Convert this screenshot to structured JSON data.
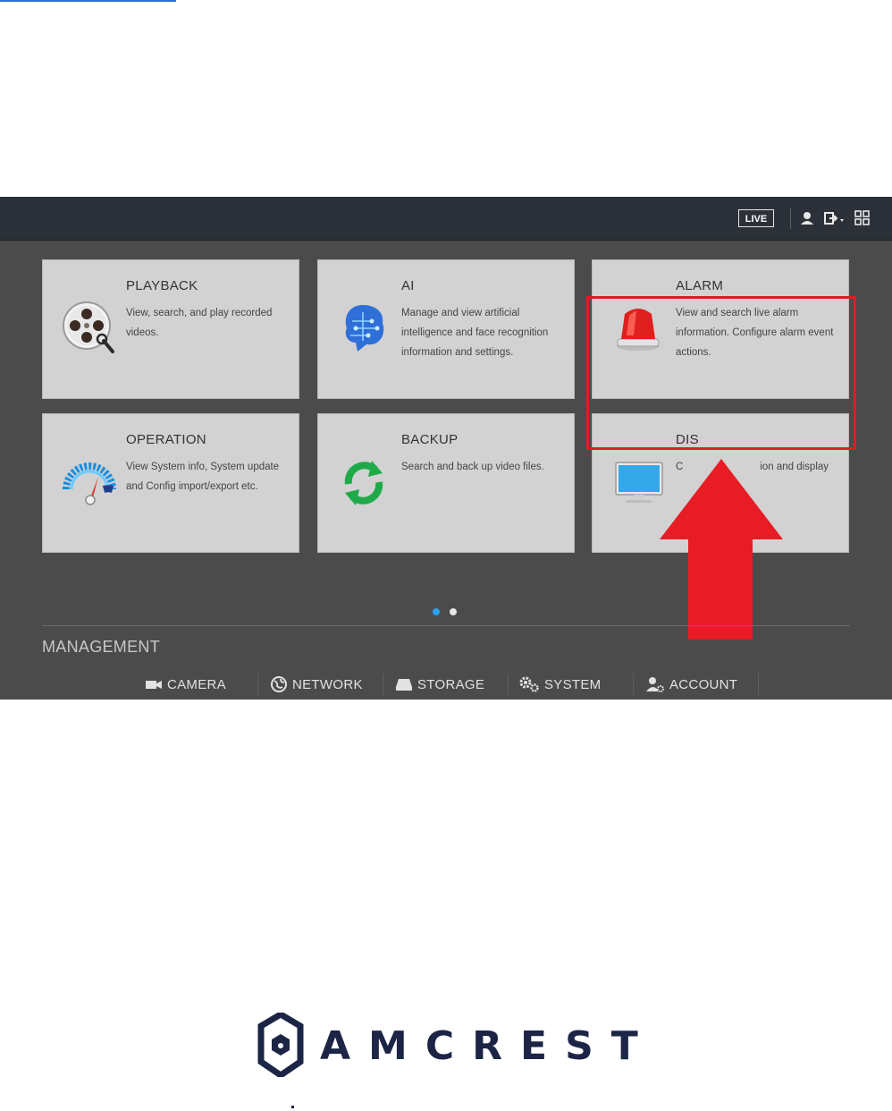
{
  "header": {
    "live_label": "LIVE"
  },
  "tiles": [
    {
      "title": "PLAYBACK",
      "desc": "View, search, and play recorded videos.",
      "icon": "film-reel-icon"
    },
    {
      "title": "AI",
      "desc": "Manage and view artificial intelligence and face recognition information and settings.",
      "icon": "ai-brain-icon"
    },
    {
      "title": "ALARM",
      "desc": "View and search live alarm information. Configure alarm event actions.",
      "icon": "alarm-siren-icon"
    },
    {
      "title": "OPERATION",
      "desc": "View System info, System update and Config import/export etc.",
      "icon": "gauge-icon"
    },
    {
      "title": "BACKUP",
      "desc": "Search and back up video files.",
      "icon": "sync-arrows-icon"
    },
    {
      "title": "DIS",
      "desc": "C",
      "desc_tail": "ion and display",
      "icon": "monitor-icon"
    }
  ],
  "pagination": {
    "total": 2,
    "active": 1
  },
  "management": {
    "title": "MANAGEMENT",
    "items": [
      {
        "label": "CAMERA",
        "icon": "camera-icon"
      },
      {
        "label": "NETWORK",
        "icon": "globe-icon"
      },
      {
        "label": "STORAGE",
        "icon": "hard-drive-icon"
      },
      {
        "label": "SYSTEM",
        "icon": "gears-icon"
      },
      {
        "label": "ACCOUNT",
        "icon": "user-settings-icon"
      }
    ]
  },
  "annotation": {
    "highlight_color": "#e01b24",
    "arrow_color": "#e81c24"
  },
  "brand": {
    "logo_text": "AMCREST",
    "color": "#1d2546"
  },
  "colors": {
    "accent_dot": "#29a3ef",
    "topbar": "#2c3139",
    "tile": "#d2d2d2"
  }
}
